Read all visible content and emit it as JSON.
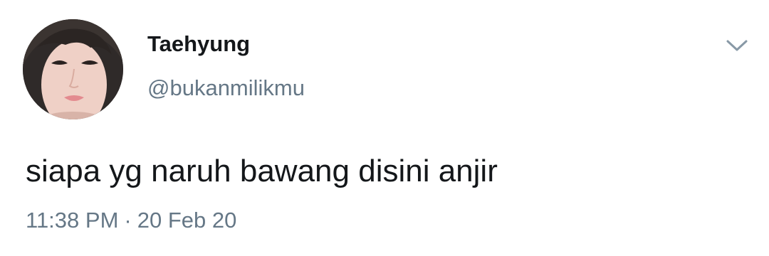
{
  "tweet": {
    "display_name": "Taehyung",
    "handle": "@bukanmilikmu",
    "text": "siapa yg naruh bawang disini anjir",
    "time": "11:38 PM",
    "separator": "·",
    "date": "20 Feb 20"
  },
  "icons": {
    "avatar": "profile-photo",
    "menu": "chevron-down-icon"
  },
  "colors": {
    "name": "#14171a",
    "secondary": "#657786",
    "chevron": "#8899a6",
    "background": "#ffffff"
  }
}
